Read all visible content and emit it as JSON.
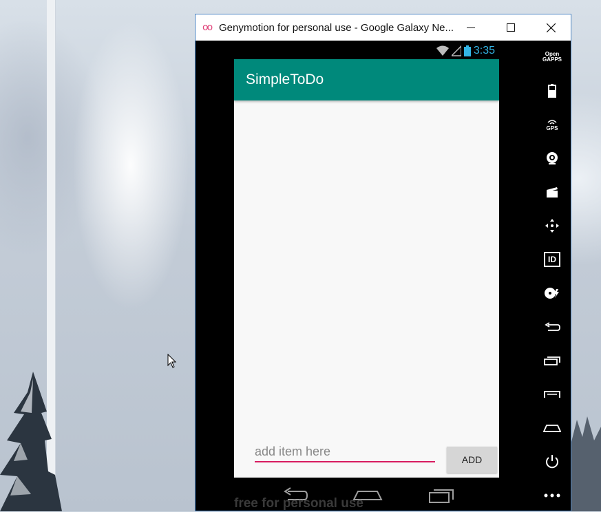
{
  "window": {
    "title": "Genymotion for personal use - Google Galaxy Ne...",
    "logo_text": "oo",
    "controls": [
      "minimize-icon",
      "maximize-icon",
      "close-icon"
    ]
  },
  "status_bar": {
    "time": "3:35",
    "icons": [
      "wifi-icon",
      "signal-icon",
      "battery-icon"
    ]
  },
  "app": {
    "title": "SimpleToDo",
    "accent_color": "#00897b",
    "input_placeholder": "add item here",
    "input_value": "",
    "add_button_label": "ADD"
  },
  "nav_bar": {
    "icons": [
      "back-icon",
      "home-icon",
      "recents-icon"
    ]
  },
  "watermark": "free for personal use",
  "toolbar": {
    "open_gapps_line1": "Open",
    "open_gapps_line2": "GAPPS",
    "gps_label": "GPS",
    "id_label": "ID",
    "tools": [
      "open-gapps-icon",
      "battery-tool-icon",
      "gps-icon",
      "camera-icon",
      "media-icon",
      "dpad-icon",
      "id-icon",
      "disk-icon",
      "back-tool-icon",
      "recents-tool-icon",
      "menu-tool-icon",
      "home-tool-icon",
      "power-icon",
      "more-icon"
    ]
  }
}
